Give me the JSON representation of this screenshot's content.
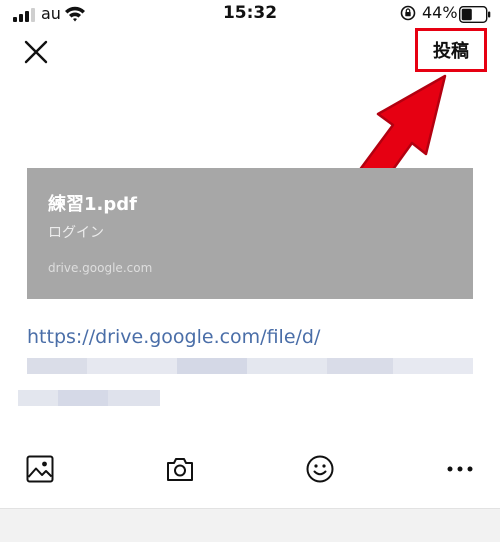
{
  "status_bar": {
    "carrier": "au",
    "time": "15:32",
    "battery_percent": "44%",
    "battery_level": 0.44
  },
  "header": {
    "close_icon": "close-icon",
    "post_label": "投稿",
    "highlight_color": "#e60012"
  },
  "preview": {
    "title": "練習1.pdf",
    "subtitle": "ログイン",
    "domain": "drive.google.com",
    "background": "#a7a7a7"
  },
  "message": {
    "url": "https://drive.google.com/file/d/",
    "link_color": "#4a6ea8"
  },
  "toolbar": {
    "icons": [
      "image-icon",
      "camera-icon",
      "emoji-icon",
      "more-icon"
    ]
  }
}
